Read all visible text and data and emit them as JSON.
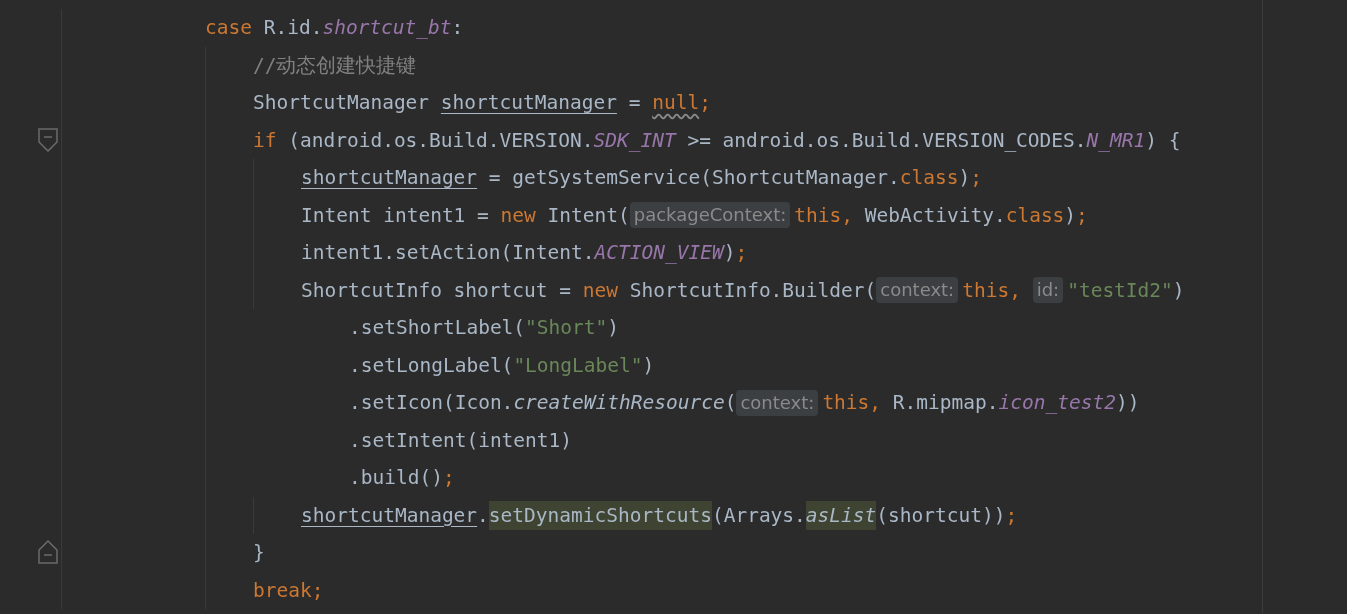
{
  "lines": [
    {
      "kind": "line",
      "tokens": [
        {
          "kind": "keyword",
          "text": "case"
        },
        {
          "kind": "plain",
          "text": " R.id."
        },
        {
          "kind": "field",
          "text": "shortcut_bt"
        },
        {
          "kind": "plain",
          "text": ":"
        }
      ],
      "children": [
        {
          "kind": "line",
          "tokens": [
            {
              "kind": "comment",
              "text": "//动态创建快捷键"
            }
          ]
        },
        {
          "kind": "line",
          "tokens": [
            {
              "kind": "plain",
              "text": "ShortcutManager "
            },
            {
              "kind": "reassigned",
              "text": "shortcutManager"
            },
            {
              "kind": "plain",
              "text": " = "
            },
            {
              "kind": "warning",
              "text": "null"
            },
            {
              "kind": "keyword",
              "text": ";"
            }
          ]
        },
        {
          "kind": "fold-start",
          "tokens": [
            {
              "kind": "keyword",
              "text": "if"
            },
            {
              "kind": "plain",
              "text": " (android.os.Build.VERSION."
            },
            {
              "kind": "field",
              "text": "SDK_INT"
            },
            {
              "kind": "plain",
              "text": " >= android.os.Build.VERSION_CODES."
            },
            {
              "kind": "field",
              "text": "N_MR1"
            },
            {
              "kind": "plain",
              "text": ") {"
            }
          ],
          "children": [
            {
              "kind": "line",
              "tokens": [
                {
                  "kind": "reassigned",
                  "text": "shortcutManager"
                },
                {
                  "kind": "plain",
                  "text": " = getSystemService(ShortcutManager."
                },
                {
                  "kind": "keyword",
                  "text": "class"
                },
                {
                  "kind": "plain",
                  "text": ")"
                },
                {
                  "kind": "keyword",
                  "text": ";"
                }
              ]
            },
            {
              "kind": "line",
              "tokens": [
                {
                  "kind": "plain",
                  "text": "Intent intent1 = "
                },
                {
                  "kind": "keyword",
                  "text": "new"
                },
                {
                  "kind": "plain",
                  "text": " Intent("
                },
                {
                  "kind": "hint",
                  "text": "packageContext:"
                },
                {
                  "kind": "keyword",
                  "text": "this,"
                },
                {
                  "kind": "plain",
                  "text": " WebActivity."
                },
                {
                  "kind": "keyword",
                  "text": "class"
                },
                {
                  "kind": "plain",
                  "text": ")"
                },
                {
                  "kind": "keyword",
                  "text": ";"
                }
              ]
            },
            {
              "kind": "line",
              "tokens": [
                {
                  "kind": "plain",
                  "text": "intent1.setAction(Intent."
                },
                {
                  "kind": "field",
                  "text": "ACTION_VIEW"
                },
                {
                  "kind": "plain",
                  "text": ")"
                },
                {
                  "kind": "keyword",
                  "text": ";"
                }
              ]
            },
            {
              "kind": "line",
              "tokens": [
                {
                  "kind": "plain",
                  "text": "ShortcutInfo shortcut = "
                },
                {
                  "kind": "keyword",
                  "text": "new"
                },
                {
                  "kind": "plain",
                  "text": " ShortcutInfo.Builder("
                },
                {
                  "kind": "hint",
                  "text": "context:"
                },
                {
                  "kind": "keyword",
                  "text": "this, "
                },
                {
                  "kind": "hint",
                  "text": "id:"
                },
                {
                  "kind": "string",
                  "text": "\"testId2\""
                },
                {
                  "kind": "plain",
                  "text": ")"
                }
              ],
              "children": [
                {
                  "kind": "continuation",
                  "tokens": [
                    {
                      "kind": "plain",
                      "text": ".setShortLabel("
                    },
                    {
                      "kind": "string",
                      "text": "\"Short\""
                    },
                    {
                      "kind": "plain",
                      "text": ")"
                    }
                  ]
                },
                {
                  "kind": "continuation",
                  "tokens": [
                    {
                      "kind": "plain",
                      "text": ".setLongLabel("
                    },
                    {
                      "kind": "string",
                      "text": "\"LongLabel\""
                    },
                    {
                      "kind": "plain",
                      "text": ")"
                    }
                  ]
                },
                {
                  "kind": "continuation",
                  "tokens": [
                    {
                      "kind": "plain",
                      "text": ".setIcon(Icon."
                    },
                    {
                      "kind": "italic",
                      "text": "createWithResource"
                    },
                    {
                      "kind": "plain",
                      "text": "("
                    },
                    {
                      "kind": "hint",
                      "text": "context:"
                    },
                    {
                      "kind": "keyword",
                      "text": "this,"
                    },
                    {
                      "kind": "plain",
                      "text": " R.mipmap."
                    },
                    {
                      "kind": "field",
                      "text": "icon_test2"
                    },
                    {
                      "kind": "plain",
                      "text": "))"
                    }
                  ]
                },
                {
                  "kind": "continuation",
                  "tokens": [
                    {
                      "kind": "plain",
                      "text": ".setIntent(intent1)"
                    }
                  ]
                },
                {
                  "kind": "continuation",
                  "tokens": [
                    {
                      "kind": "plain",
                      "text": ".build()"
                    },
                    {
                      "kind": "keyword",
                      "text": ";"
                    }
                  ]
                }
              ]
            },
            {
              "kind": "line",
              "tokens": [
                {
                  "kind": "reassigned",
                  "text": "shortcutManager"
                },
                {
                  "kind": "plain",
                  "text": "."
                },
                {
                  "kind": "highlight",
                  "text": "setDynamicShortcuts"
                },
                {
                  "kind": "plain",
                  "text": "(Arrays."
                },
                {
                  "kind": "highlight-italic",
                  "text": "asList"
                },
                {
                  "kind": "plain",
                  "text": "(shortcut))"
                },
                {
                  "kind": "keyword",
                  "text": ";"
                }
              ]
            }
          ]
        },
        {
          "kind": "fold-end",
          "tokens": [
            {
              "kind": "plain",
              "text": "}"
            }
          ]
        },
        {
          "kind": "line",
          "tokens": [
            {
              "kind": "keyword",
              "text": "break"
            },
            {
              "kind": "keyword",
              "text": ";"
            }
          ]
        }
      ]
    }
  ]
}
